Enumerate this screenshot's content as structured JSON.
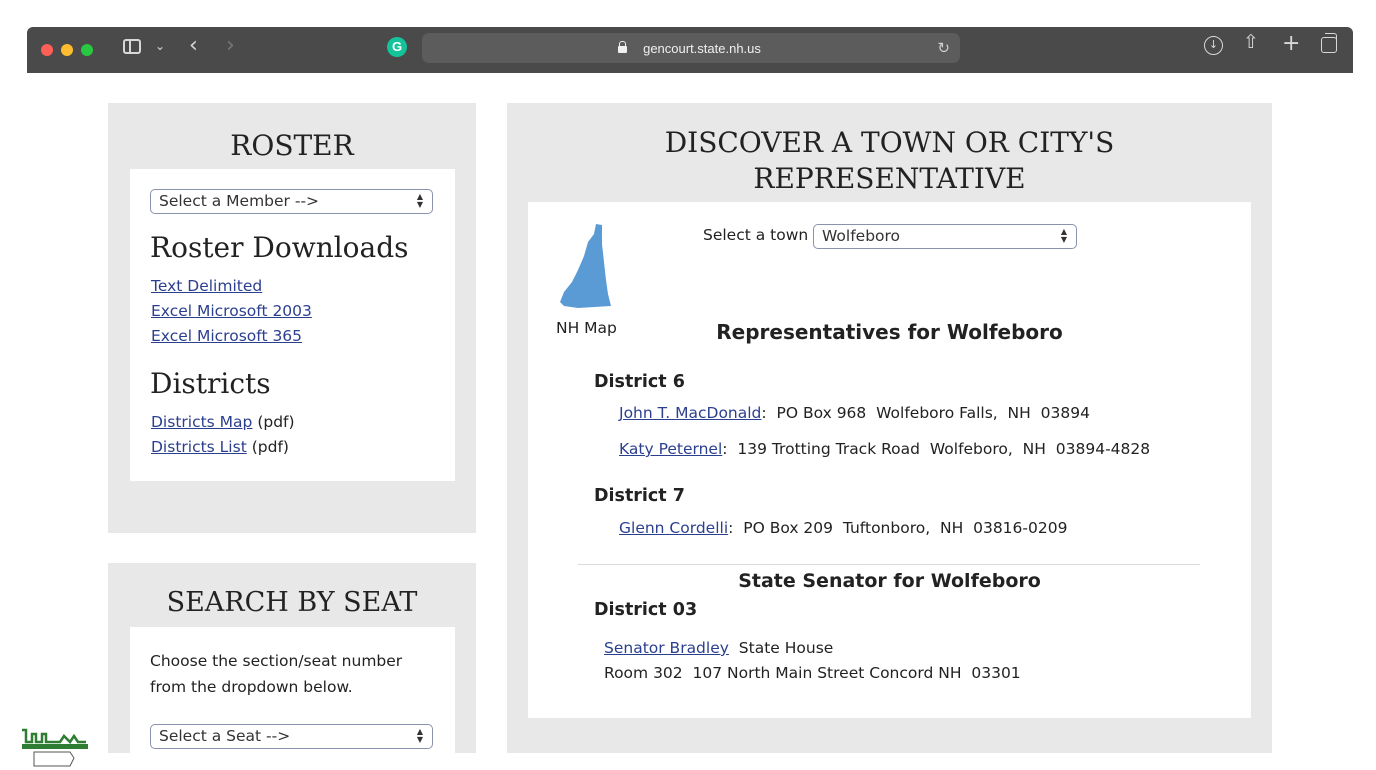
{
  "browser": {
    "url": "gencourt.state.nh.us",
    "grammarly_label": "G"
  },
  "roster": {
    "title": "ROSTER",
    "member_select": "Select a Member -->",
    "downloads_heading": "Roster Downloads",
    "downloads": [
      "Text Delimited",
      "Excel Microsoft 2003",
      "Excel Microsoft 365"
    ],
    "districts_heading": "Districts",
    "districts_map_link": "Districts Map",
    "districts_list_link": "Districts List",
    "pdf_suffix": "(pdf)"
  },
  "seat": {
    "title": "SEARCH BY SEAT",
    "instructions_line1": "Choose the section/seat number",
    "instructions_line2": "from the dropdown below.",
    "seat_select": "Select a Seat -->"
  },
  "discover": {
    "title_line1": "DISCOVER A TOWN OR CITY'S",
    "title_line2": "REPRESENTATIVE",
    "map_label": "NH Map",
    "town_label": "Select a town",
    "town_value": "Wolfeboro",
    "reps_heading": "Representatives for Wolfeboro",
    "districts": [
      {
        "name": "District 6",
        "reps": [
          {
            "name": "John T. MacDonald",
            "address": ":  PO Box 968  Wolfeboro Falls,  NH  03894"
          },
          {
            "name": "Katy Peternel",
            "address": ":  139 Trotting Track Road  Wolfeboro,  NH  03894-4828"
          }
        ]
      },
      {
        "name": "District 7",
        "reps": [
          {
            "name": "Glenn Cordelli",
            "address": ":  PO Box 209  Tuftonboro,  NH  03816-0209"
          }
        ]
      }
    ],
    "senator_heading": "State Senator for Wolfeboro",
    "senator_district": "District 03",
    "senator_name": "Senator Bradley",
    "senator_address_line1": "  State House",
    "senator_address_line2": "Room 302  107 North Main Street Concord NH  03301"
  },
  "colors": {
    "panel_bg": "#e8e8e8",
    "link": "#2b3f8f",
    "map_blue": "#5b9bd5",
    "chrome": "#4a4a4a"
  }
}
